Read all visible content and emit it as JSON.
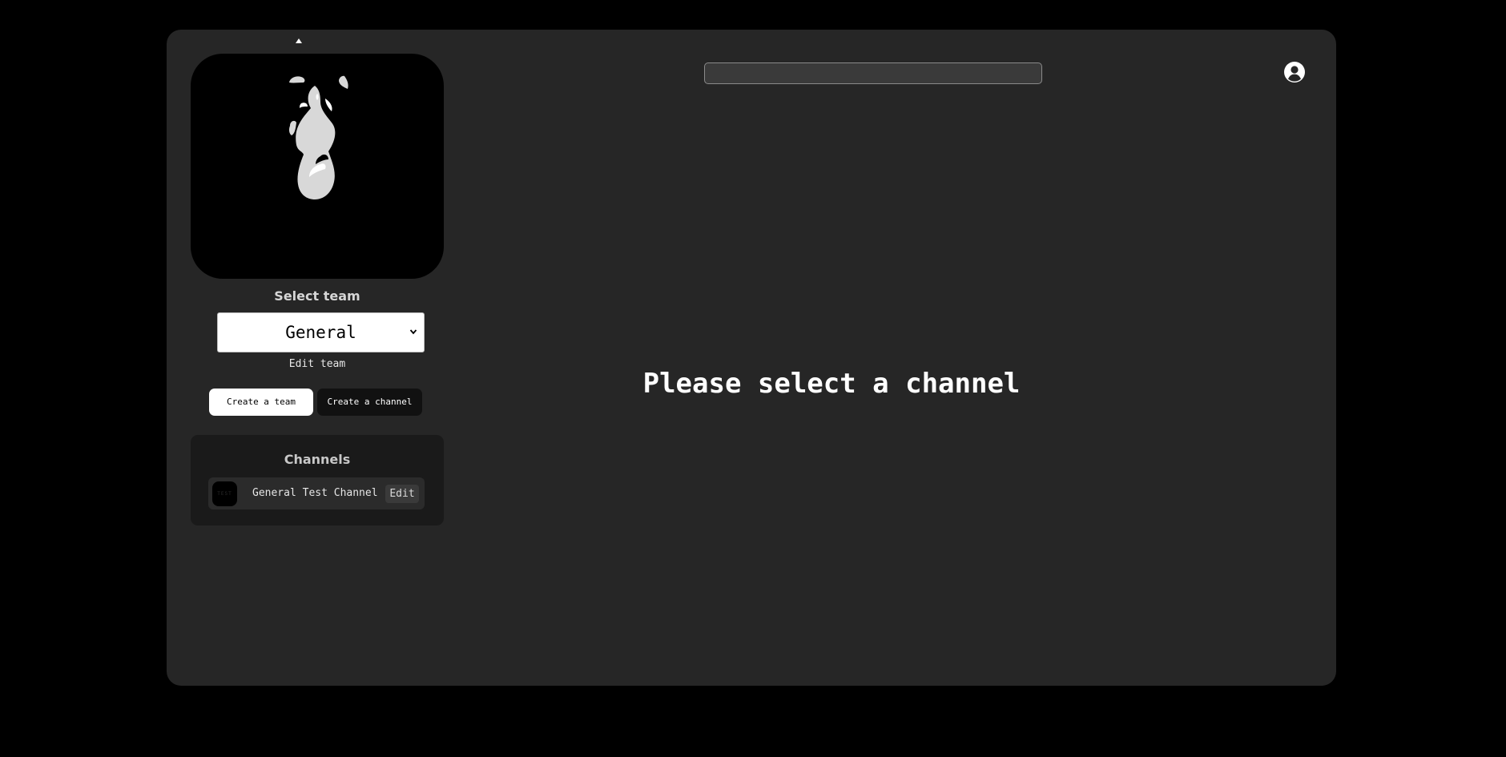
{
  "sidebar": {
    "select_team_label": "Select team",
    "team_select": {
      "selected": "General"
    },
    "edit_team_label": "Edit team",
    "create_team_label": "Create a team",
    "create_channel_label": "Create a channel",
    "channels": {
      "title": "Channels",
      "items": [
        {
          "avatar_text": "TEST",
          "name": "General Test Channel",
          "edit_label": "Edit"
        }
      ]
    }
  },
  "header": {
    "search": {
      "value": "",
      "placeholder": ""
    },
    "user_icon": "user-circle-icon"
  },
  "main": {
    "empty_message": "Please select a channel"
  },
  "colors": {
    "page_background": "#000000",
    "frame_background": "#262626",
    "panel_background": "#1a1a1a",
    "text_primary": "#ffffff"
  }
}
